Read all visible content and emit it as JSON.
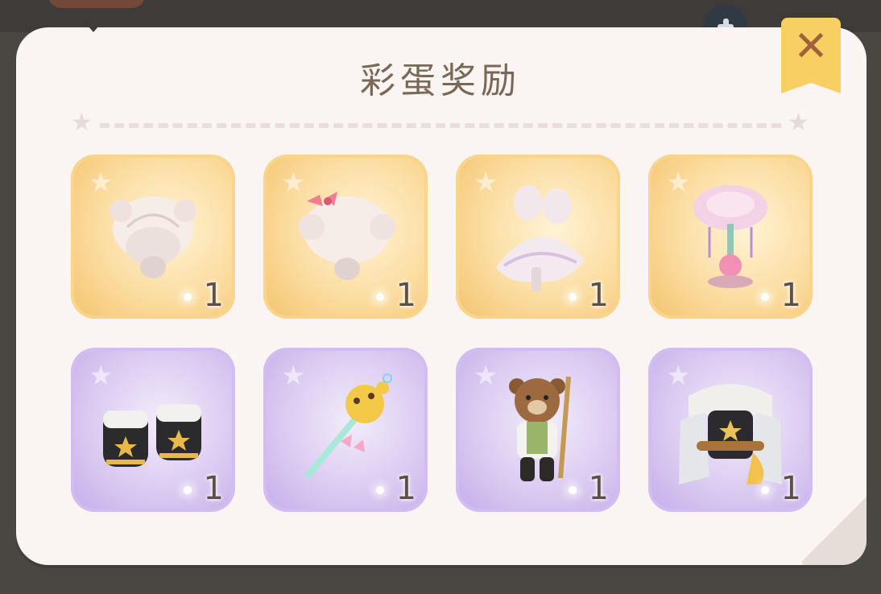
{
  "dialog": {
    "title": "彩蛋奖励",
    "close_label": "✕"
  },
  "rewards": [
    {
      "name": "white-curly-hair-buns",
      "count": "1",
      "tier": "gold"
    },
    {
      "name": "white-curly-hair-pink-bow",
      "count": "1",
      "tier": "gold"
    },
    {
      "name": "white-feather-dress",
      "count": "1",
      "tier": "gold"
    },
    {
      "name": "pink-feather-lamp-ornament",
      "count": "1",
      "tier": "gold"
    },
    {
      "name": "black-gold-star-boots",
      "count": "1",
      "tier": "purple"
    },
    {
      "name": "giraffe-magic-wand",
      "count": "1",
      "tier": "purple"
    },
    {
      "name": "teddy-bear-with-staff",
      "count": "1",
      "tier": "purple"
    },
    {
      "name": "black-white-fur-coat",
      "count": "1",
      "tier": "purple"
    }
  ],
  "colors": {
    "gold_card": "#fbdc9f",
    "purple_card": "#d8c8f0",
    "panel": "#faf4f2",
    "title": "#7a6856",
    "close_button": "#f7cf63"
  }
}
